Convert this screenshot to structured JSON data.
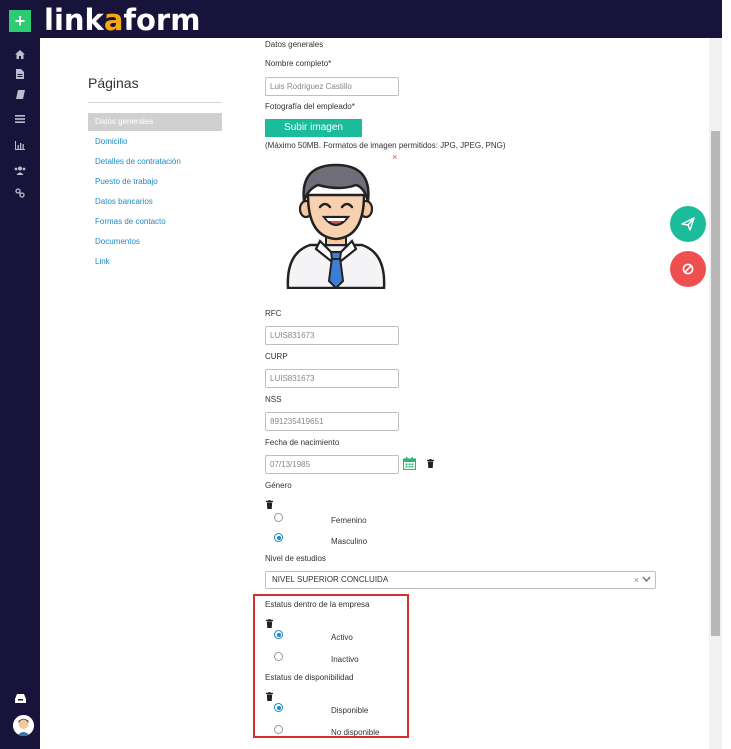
{
  "app": {
    "logo_part1": "link",
    "logo_accent": "a",
    "logo_part2": "form",
    "plus_label": "+",
    "brand_color": "#17133a",
    "accent_color": "#f3a712",
    "action_color": "#1abc9c",
    "danger_color": "#ef4f4f"
  },
  "rail": {
    "icons": [
      "home-icon",
      "document-icon",
      "book-icon",
      "list-icon",
      "bar-chart-icon",
      "users-icon",
      "link-icon"
    ],
    "bottom_icons": [
      "inbox-icon",
      "user-avatar"
    ]
  },
  "pages": {
    "title": "Páginas",
    "items": [
      "Datos generales",
      "Domicilio",
      "Detalles de contratación",
      "Puesto de trabajo",
      "Datos bancarios",
      "Formas de contacto",
      "Documentos",
      "Link"
    ],
    "active_index": 0
  },
  "form": {
    "section_title": "Datos generales",
    "nombre_label": "Nombre completo*",
    "nombre_value": "Luis Rodriguez Castillo",
    "foto_label": "Fotografía del empleado*",
    "upload_label": "Subir imagen",
    "upload_hint": "(Máximo 50MB. Formatos de imagen permitidos: JPG, JPEG, PNG)",
    "remove_mark": "×",
    "rfc_label": "RFC",
    "rfc_value": "LUIS831673",
    "curp_label": "CURP",
    "curp_value": "LUIS831673",
    "nss_label": "NSS",
    "nss_value": "891235419651",
    "fecha_label": "Fecha de nacimiento",
    "fecha_value": "07/13/1985",
    "genero_label": "Género",
    "genero_options": [
      "Femenino",
      "Masculino"
    ],
    "genero_selected": "Masculino",
    "estudios_label": "Nivel de estudios",
    "estudios_value": "NIVEL SUPERIOR CONCLUIDA",
    "estudios_clear": "×",
    "estatus_label": "Estatus dentro de la empresa",
    "estatus_options": [
      "Activo",
      "Inactivo"
    ],
    "estatus_selected": "Activo",
    "disponibilidad_label": "Estatus de disponibilidad",
    "disponibilidad_options": [
      "Disponible",
      "No disponible"
    ],
    "disponibilidad_selected": "Disponible"
  },
  "fabs": {
    "send_icon": "paper-plane-icon",
    "cancel_icon": "ban-icon"
  }
}
